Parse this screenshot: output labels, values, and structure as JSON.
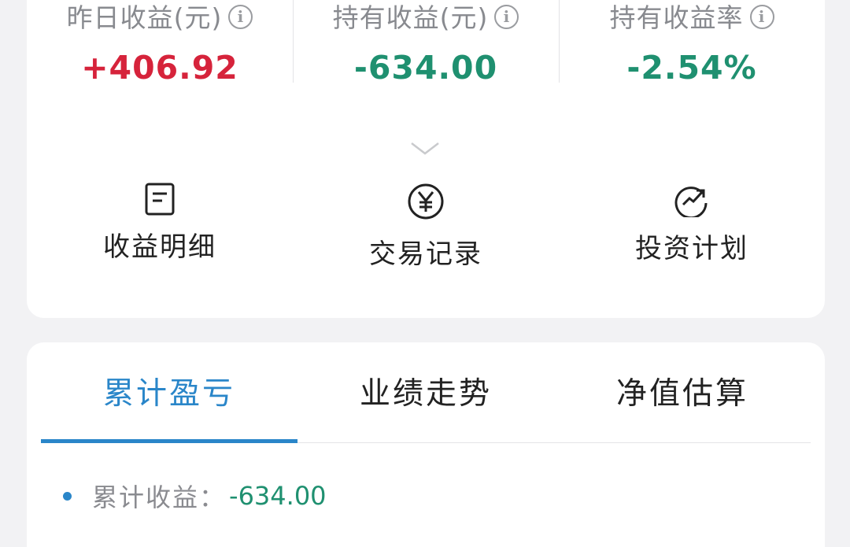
{
  "stats": [
    {
      "label": "昨日收益(元)",
      "value": "+406.92",
      "tone": "red"
    },
    {
      "label": "持有收益(元)",
      "value": "-634.00",
      "tone": "green"
    },
    {
      "label": "持有收益率",
      "value": "-2.54%",
      "tone": "green"
    }
  ],
  "info_icon_glyph": "i",
  "actions": [
    {
      "label": "收益明细",
      "icon": "document-icon"
    },
    {
      "label": "交易记录",
      "icon": "yen-circle-icon"
    },
    {
      "label": "投资计划",
      "icon": "trend-circle-icon"
    }
  ],
  "tabs": [
    {
      "label": "累计盈亏",
      "active": true
    },
    {
      "label": "业绩走势",
      "active": false
    },
    {
      "label": "净值估算",
      "active": false
    }
  ],
  "summary": {
    "label": "累计收益：",
    "value": "-634.00"
  },
  "colors": {
    "red": "#d6233b",
    "green": "#1f9070",
    "accent": "#2a86c9",
    "muted": "#888a8f"
  }
}
